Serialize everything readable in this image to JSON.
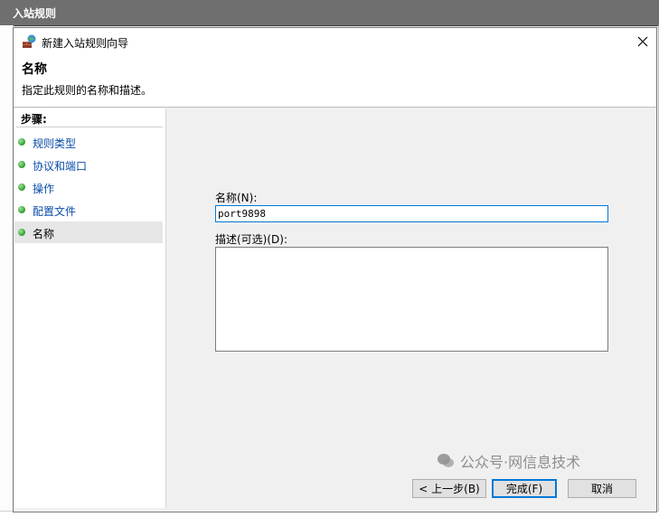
{
  "background": {
    "window_title": "入站规则"
  },
  "dialog": {
    "title": "新建入站规则向导",
    "close_label": "✕"
  },
  "header": {
    "title": "名称",
    "description": "指定此规则的名称和描述。"
  },
  "steps": {
    "label": "步骤:",
    "items": [
      {
        "label": "规则类型"
      },
      {
        "label": "协议和端口"
      },
      {
        "label": "操作"
      },
      {
        "label": "配置文件"
      },
      {
        "label": "名称",
        "active": true
      }
    ]
  },
  "form": {
    "name_label": "名称(N):",
    "name_value": "port9898",
    "description_label": "描述(可选)(D):",
    "description_value": ""
  },
  "buttons": {
    "back": "< 上一步(B)",
    "finish": "完成(F)",
    "cancel": "取消"
  },
  "watermark": {
    "text": "公众号·网信息技术"
  },
  "colors": {
    "focus": "#0078d7",
    "step_link": "#0a4da8",
    "step_dot": "#2d9b2b"
  }
}
